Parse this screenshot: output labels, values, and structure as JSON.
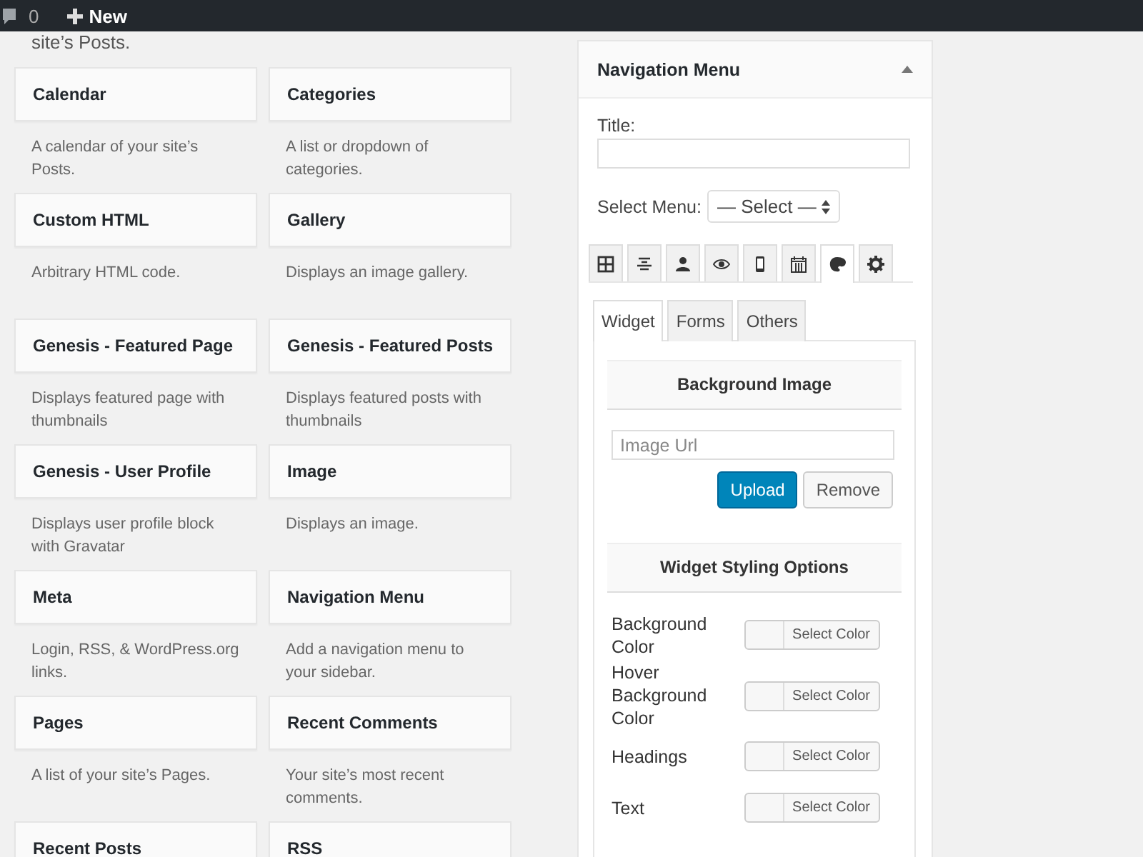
{
  "admin_bar": {
    "comments_count": "0",
    "new_label": "New"
  },
  "widgets_leftover": "site’s Posts.",
  "widgets": [
    {
      "title": "Calendar",
      "description": "A calendar of your site’s Posts."
    },
    {
      "title": "Categories",
      "description": "A list or dropdown of categories."
    },
    {
      "title": "Custom HTML",
      "description": "Arbitrary HTML code."
    },
    {
      "title": "Gallery",
      "description": "Displays an image gallery."
    },
    {
      "title": "Genesis - Featured Page",
      "description": "Displays featured page with thumbnails"
    },
    {
      "title": "Genesis - Featured Posts",
      "description": "Displays featured posts with thumbnails"
    },
    {
      "title": "Genesis - User Profile",
      "description": "Displays user profile block with Gravatar"
    },
    {
      "title": "Image",
      "description": "Displays an image."
    },
    {
      "title": "Meta",
      "description": "Login, RSS, & WordPress.org links."
    },
    {
      "title": "Navigation Menu",
      "description": "Add a navigation menu to your sidebar."
    },
    {
      "title": "Pages",
      "description": "A list of your site’s Pages."
    },
    {
      "title": "Recent Comments",
      "description": "Your site’s most recent comments."
    },
    {
      "title": "Recent Posts"
    },
    {
      "title": "RSS"
    }
  ],
  "panel": {
    "title": "Navigation Menu",
    "expanded": true,
    "title_label": "Title:",
    "select_label": "Select Menu:",
    "select_value": "— Select —",
    "icon_tabs": [
      {
        "kind": "grid",
        "selected": false
      },
      {
        "kind": "align",
        "selected": false
      },
      {
        "kind": "user",
        "selected": false
      },
      {
        "kind": "eye",
        "selected": false
      },
      {
        "kind": "phone",
        "selected": false
      },
      {
        "kind": "calendar",
        "selected": false
      },
      {
        "kind": "palette",
        "selected": true
      },
      {
        "kind": "gear",
        "selected": false
      }
    ],
    "tabs": [
      {
        "label": "Widget",
        "selected": true
      },
      {
        "label": "Forms",
        "selected": false
      },
      {
        "label": "Others",
        "selected": false
      }
    ],
    "background_section": "Background Image",
    "image_url_placeholder": "Image Url",
    "upload_button": "Upload",
    "remove_button": "Remove",
    "styling_section": "Widget Styling Options",
    "color_options": [
      {
        "label": "Background Color",
        "button": "Select Color"
      },
      {
        "label": "Hover Background Color",
        "button": "Select Color"
      },
      {
        "label": "Headings",
        "button": "Select Color"
      },
      {
        "label": "Text",
        "button": "Select Color"
      }
    ]
  }
}
